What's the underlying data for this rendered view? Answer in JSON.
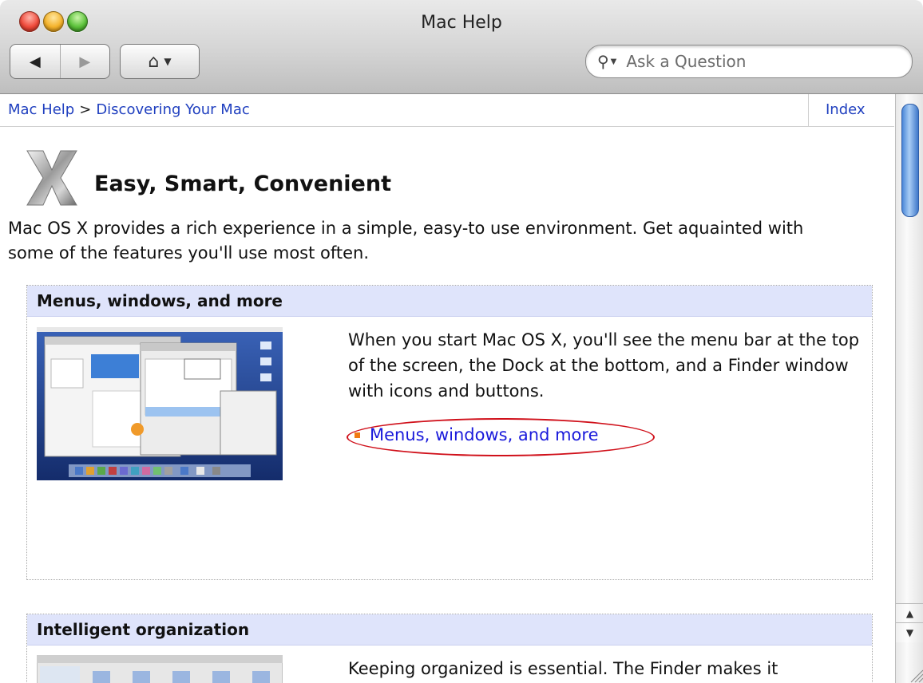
{
  "window": {
    "title": "Mac Help"
  },
  "toolbar": {
    "back_icon": "back-arrow-icon",
    "forward_icon": "forward-arrow-icon",
    "home_icon": "home-icon",
    "search_placeholder": "Ask a Question"
  },
  "breadcrumb": {
    "items": [
      "Mac Help",
      "Discovering Your Mac"
    ],
    "separator": ">",
    "index_label": "Index"
  },
  "page": {
    "heading": "Easy, Smart, Convenient",
    "intro": "Mac OS X provides a rich experience in a simple, easy-to use environment. Get aquainted with some of the features you'll use most often."
  },
  "sections": [
    {
      "title": "Menus, windows, and more",
      "body": "When you start Mac OS X, you'll see the menu bar at the top of the screen, the Dock at the bottom, and a Finder window with icons and buttons.",
      "link": "Menus, windows, and more"
    },
    {
      "title": "Intelligent organization",
      "body": "Keeping organized is essential. The Finder makes it"
    }
  ],
  "colors": {
    "link": "#1a1adb",
    "section_header_bg": "#dfe4fb",
    "bullet": "#f07a12",
    "annotation": "#d0101a"
  }
}
